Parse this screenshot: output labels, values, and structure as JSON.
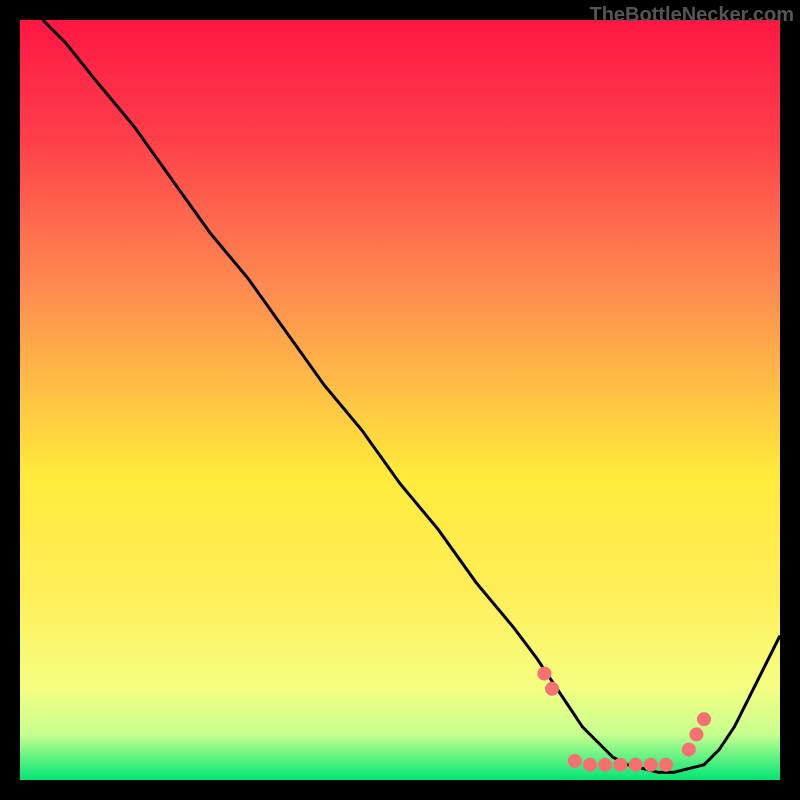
{
  "watermark": "TheBottleNecker.com",
  "chart_data": {
    "type": "line",
    "title": "",
    "xlabel": "",
    "ylabel": "",
    "xlim": [
      0,
      100
    ],
    "ylim": [
      0,
      100
    ],
    "gradient_background": {
      "top_color": "#FF1744",
      "mid_color": "#FFEB3B",
      "bottom_color": "#00E676"
    },
    "series": [
      {
        "name": "bottleneck-curve",
        "color": "#000000",
        "x": [
          3,
          6,
          10,
          15,
          20,
          25,
          30,
          35,
          40,
          45,
          50,
          55,
          60,
          65,
          68,
          70,
          72,
          74,
          76,
          78,
          80,
          82,
          84,
          86,
          88,
          90,
          92,
          94,
          96,
          100
        ],
        "y": [
          100,
          97,
          92,
          86,
          79,
          72,
          66,
          59,
          52,
          46,
          39,
          33,
          26,
          20,
          16,
          13,
          10,
          7,
          5,
          3,
          2,
          1.5,
          1,
          1,
          1.5,
          2,
          4,
          7,
          11,
          19
        ]
      }
    ],
    "markers": {
      "name": "optimal-range-dots",
      "color": "#F57171",
      "x": [
        69,
        70,
        73,
        75,
        77,
        79,
        81,
        83,
        85,
        88,
        89,
        90
      ],
      "y": [
        14,
        12,
        2.5,
        2,
        2,
        2,
        2,
        2,
        2,
        4,
        6,
        8
      ]
    }
  }
}
